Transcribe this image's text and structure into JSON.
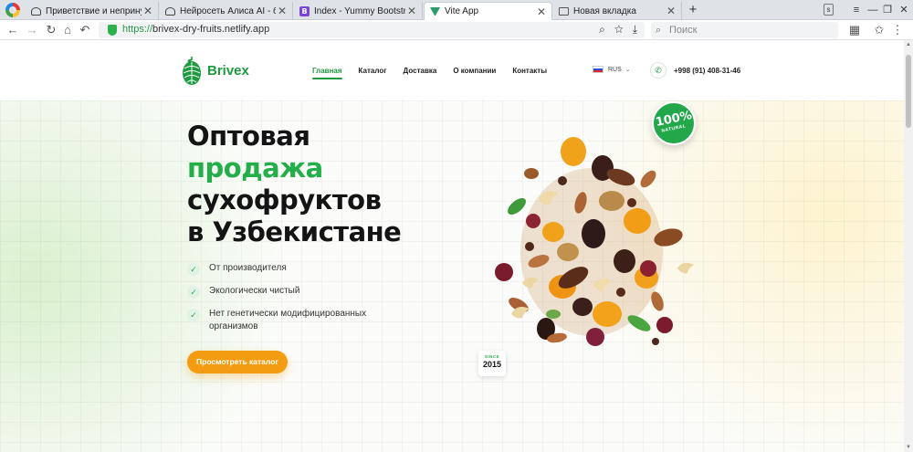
{
  "browser": {
    "tabs": [
      {
        "label": "Приветствие и непринуждённый",
        "icon": "cloud-icon",
        "active": false
      },
      {
        "label": "Нейросеть Алиса AI - бесплатно",
        "icon": "cloud-icon",
        "active": false
      },
      {
        "label": "Index - Yummy Bootstrap Template",
        "icon": "bootstrap-icon",
        "active": false
      },
      {
        "label": "Vite App",
        "icon": "vite-icon",
        "active": true
      },
      {
        "label": "Новая вкладка",
        "icon": "page-icon",
        "active": false
      }
    ],
    "url_protocol": "https://",
    "url_host": "brivex-dry-fruits.netlify.app",
    "search_placeholder": "Поиск"
  },
  "site": {
    "brand": "Brivex",
    "nav": [
      {
        "label": "Главная",
        "active": true
      },
      {
        "label": "Каталог",
        "active": false
      },
      {
        "label": "Доставка",
        "active": false
      },
      {
        "label": "О компании",
        "active": false
      },
      {
        "label": "Контакты",
        "active": false
      }
    ],
    "language": "RUS",
    "phone": "+998 (91) 408-31-46",
    "hero": {
      "title_line1": "Оптовая",
      "title_line2": "продажа",
      "title_line3": "сухофруктов",
      "title_line4": "в Узбекистане",
      "features": [
        "От производителя",
        "Экологически чистый",
        "Нет генетически модифицированных организмов"
      ],
      "cta_label": "Просмотреть каталог"
    },
    "badge": {
      "big": "100%",
      "small": "NATURAL"
    },
    "since": {
      "label": "SINCE",
      "year": "2015"
    },
    "colors": {
      "accent_green": "#24ae4a",
      "cta_orange": "#f39c12"
    }
  }
}
